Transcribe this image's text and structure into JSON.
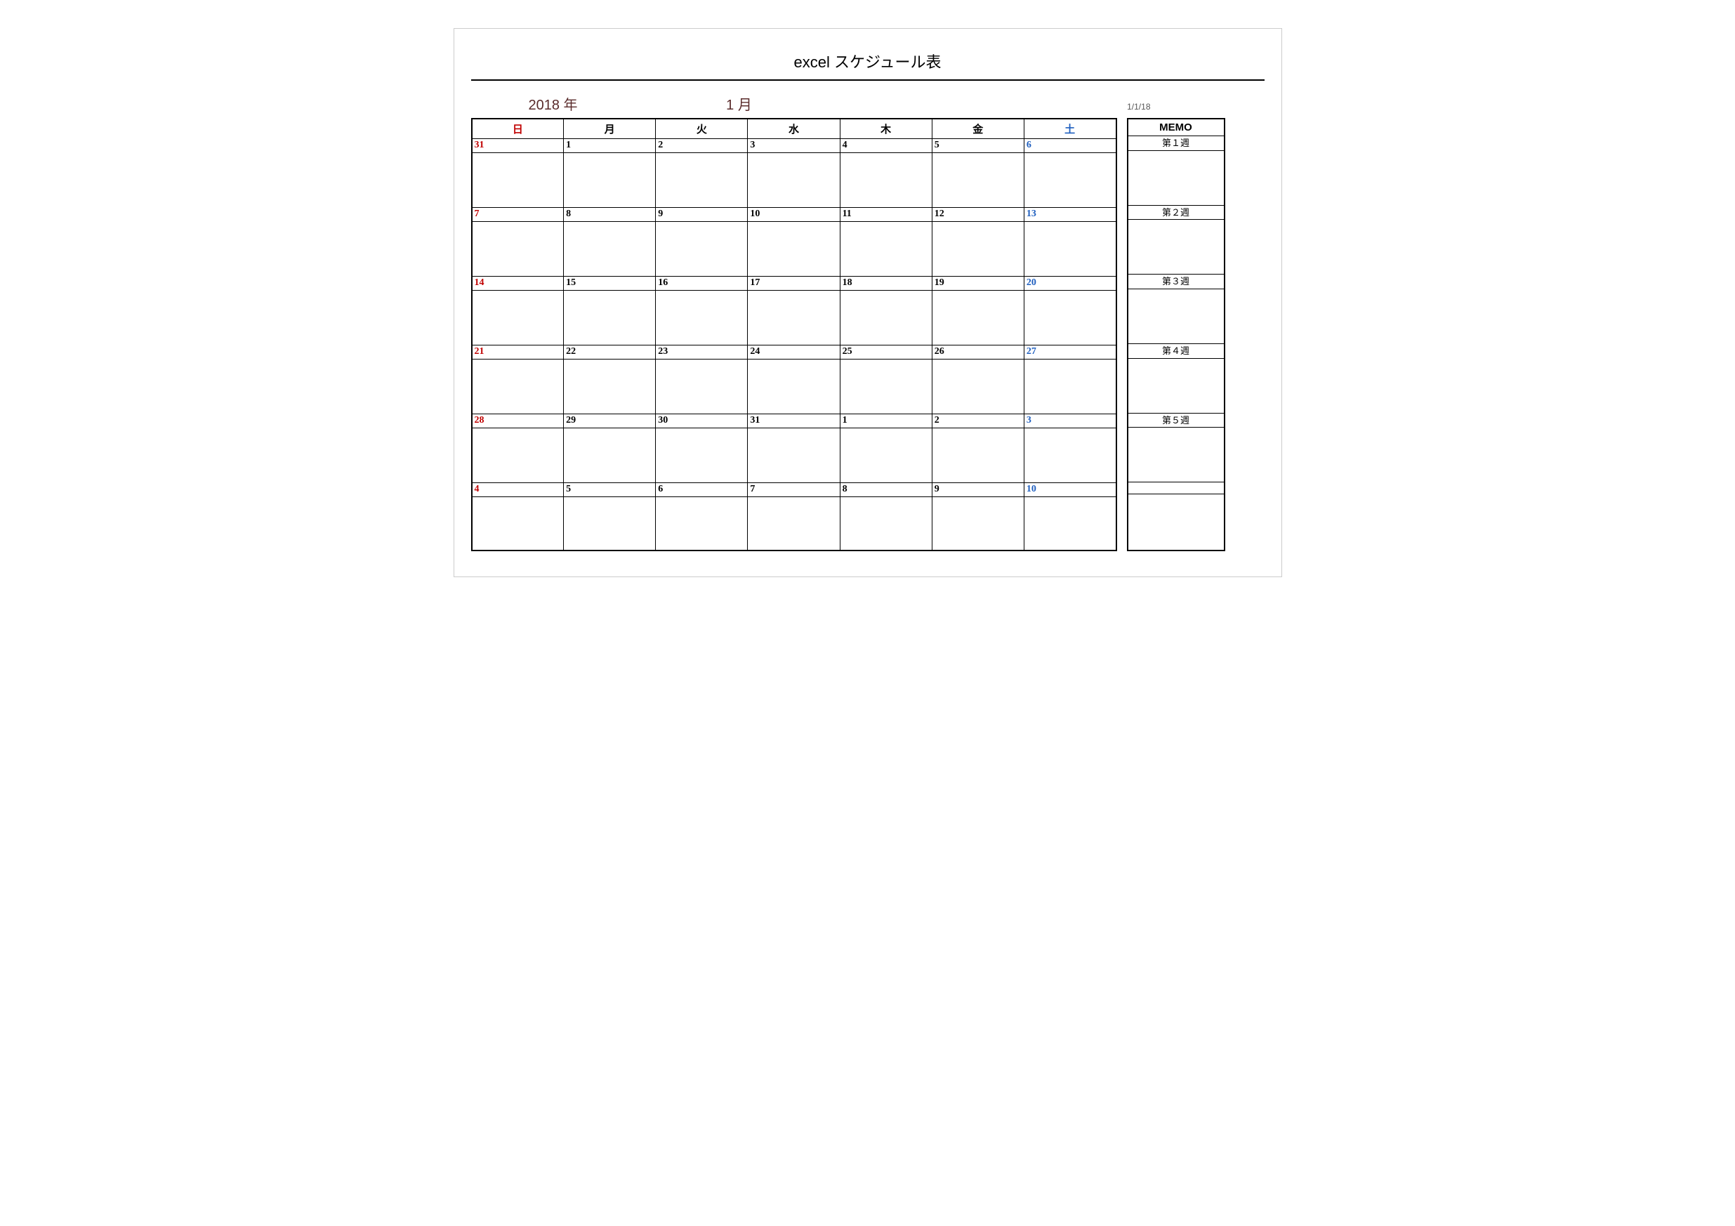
{
  "title": "excel スケジュール表",
  "year_label": "2018 年",
  "month_label": "1 月",
  "ref_date": "1/1/18",
  "day_headers": [
    "日",
    "月",
    "火",
    "水",
    "木",
    "金",
    "土"
  ],
  "memo_header": "MEMO",
  "weeks": [
    {
      "days": [
        "31",
        "1",
        "2",
        "3",
        "4",
        "5",
        "6"
      ],
      "memo": "第１週"
    },
    {
      "days": [
        "7",
        "8",
        "9",
        "10",
        "11",
        "12",
        "13"
      ],
      "memo": "第２週"
    },
    {
      "days": [
        "14",
        "15",
        "16",
        "17",
        "18",
        "19",
        "20"
      ],
      "memo": "第３週"
    },
    {
      "days": [
        "21",
        "22",
        "23",
        "24",
        "25",
        "26",
        "27"
      ],
      "memo": "第４週"
    },
    {
      "days": [
        "28",
        "29",
        "30",
        "31",
        "1",
        "2",
        "3"
      ],
      "memo": "第５週"
    },
    {
      "days": [
        "4",
        "5",
        "6",
        "7",
        "8",
        "9",
        "10"
      ],
      "memo": ""
    }
  ]
}
